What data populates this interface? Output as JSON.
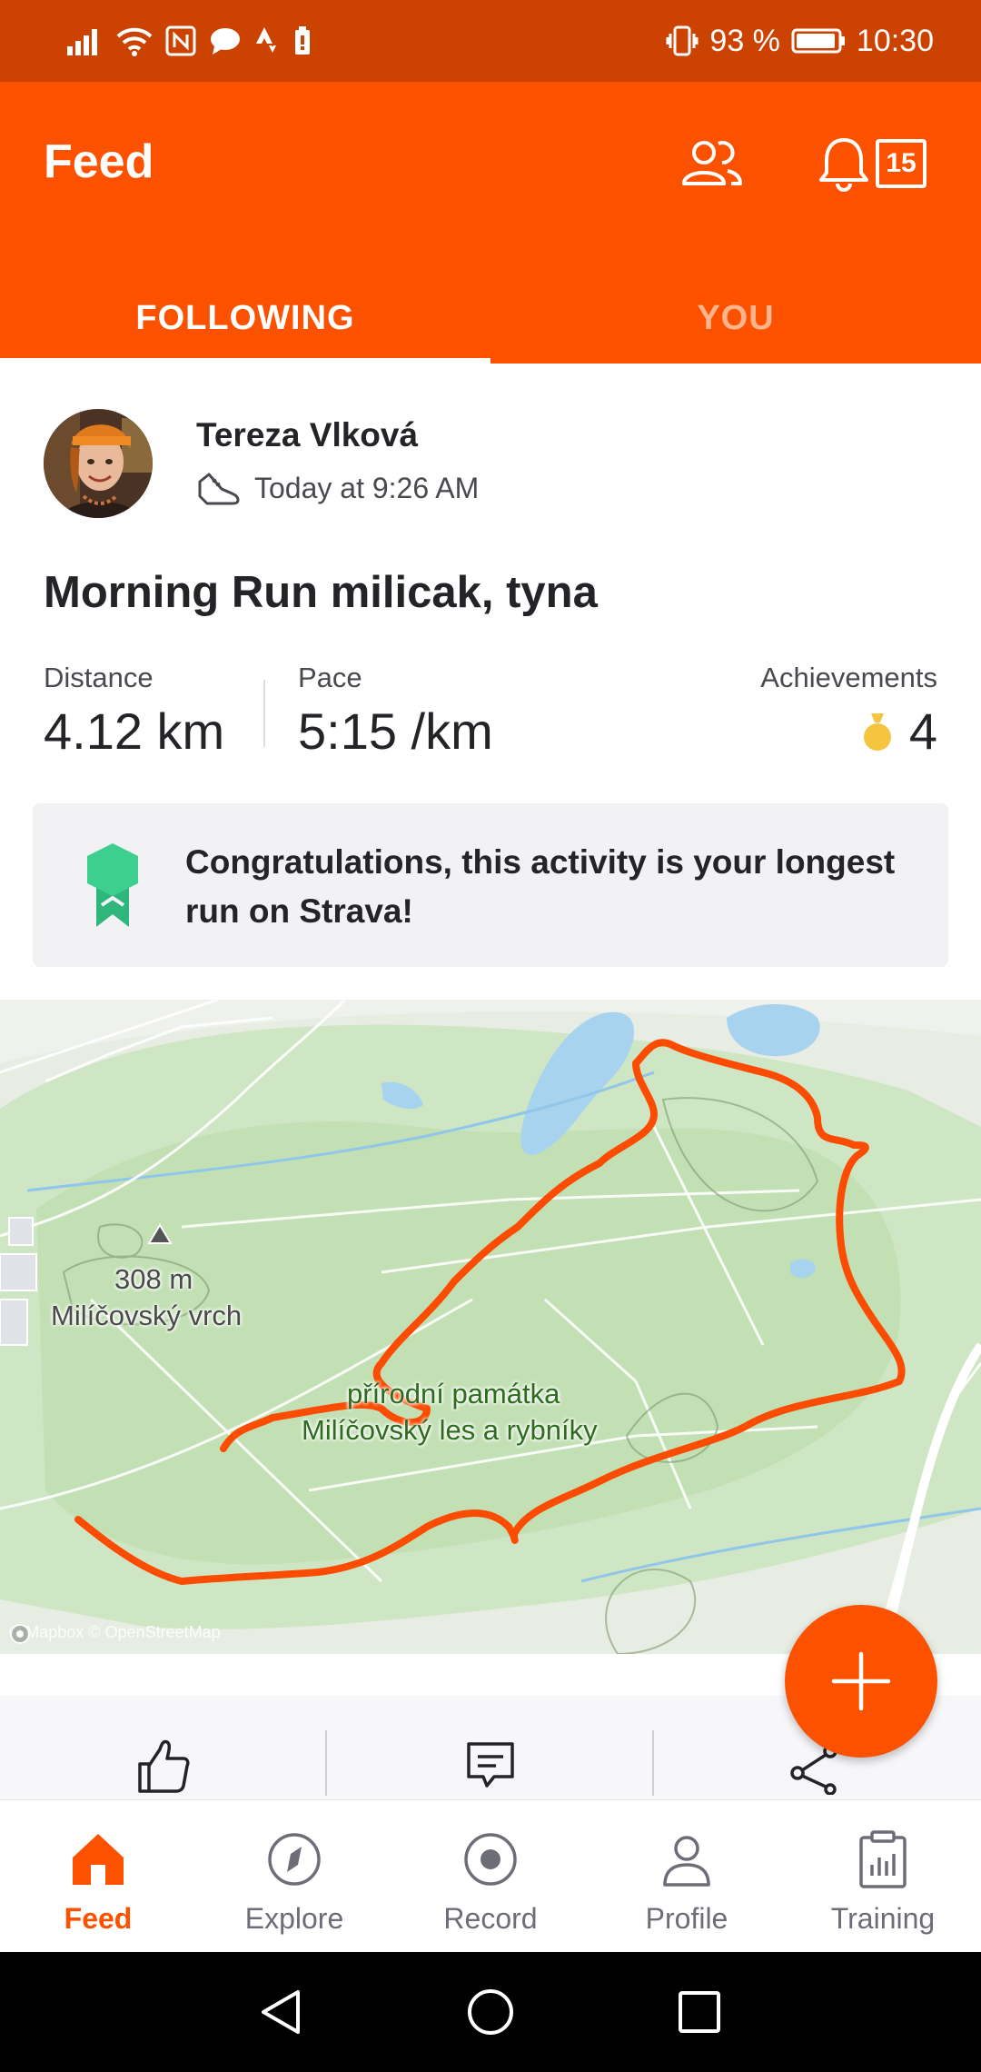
{
  "status_bar": {
    "battery_percent": "93 %",
    "time": "10:30",
    "icons": [
      "signal-icon",
      "wifi-icon",
      "nfc-icon",
      "message-icon",
      "strava-icon",
      "battery-saver-icon",
      "vibrate-icon",
      "battery-icon"
    ]
  },
  "header": {
    "title": "Feed",
    "notification_count": "15",
    "friends_icon": "friends-icon",
    "bell_icon": "bell-icon"
  },
  "tabs": [
    {
      "label": "FOLLOWING",
      "active": true
    },
    {
      "label": "YOU",
      "active": false
    }
  ],
  "activity": {
    "athlete_name": "Tereza Vlková",
    "timestamp": "Today at 9:26 AM",
    "sport_icon": "shoe-icon",
    "title": "Morning Run milicak, tyna",
    "stats": {
      "distance_label": "Distance",
      "distance_value": "4.12 km",
      "pace_label": "Pace",
      "pace_value": "5:15 /km",
      "achievements_label": "Achievements",
      "achievements_value": "4"
    },
    "achievement_banner": "Congratulations, this activity is your longest run on Strava!",
    "map": {
      "peak_elevation": "308 m",
      "peak_name": "Milíčovský vrch",
      "area_name_line1": "přírodní památka",
      "area_name_line2": "Milíčovský les a rybníky",
      "attribution": "© Mapbox © OpenStreetMap"
    }
  },
  "actions": [
    "kudos-icon",
    "comment-icon",
    "share-icon"
  ],
  "fab_icon": "plus-icon",
  "bottom_nav": [
    {
      "label": "Feed",
      "icon": "home-icon",
      "active": true
    },
    {
      "label": "Explore",
      "icon": "compass-icon",
      "active": false
    },
    {
      "label": "Record",
      "icon": "record-icon",
      "active": false
    },
    {
      "label": "Profile",
      "icon": "profile-icon",
      "active": false
    },
    {
      "label": "Training",
      "icon": "training-icon",
      "active": false
    }
  ],
  "colors": {
    "brand": "#fc5200",
    "status_bar": "#cc4200",
    "route": "#fc4c02",
    "achievement_green": "#2fb67c",
    "medal_gold": "#f5c542"
  }
}
